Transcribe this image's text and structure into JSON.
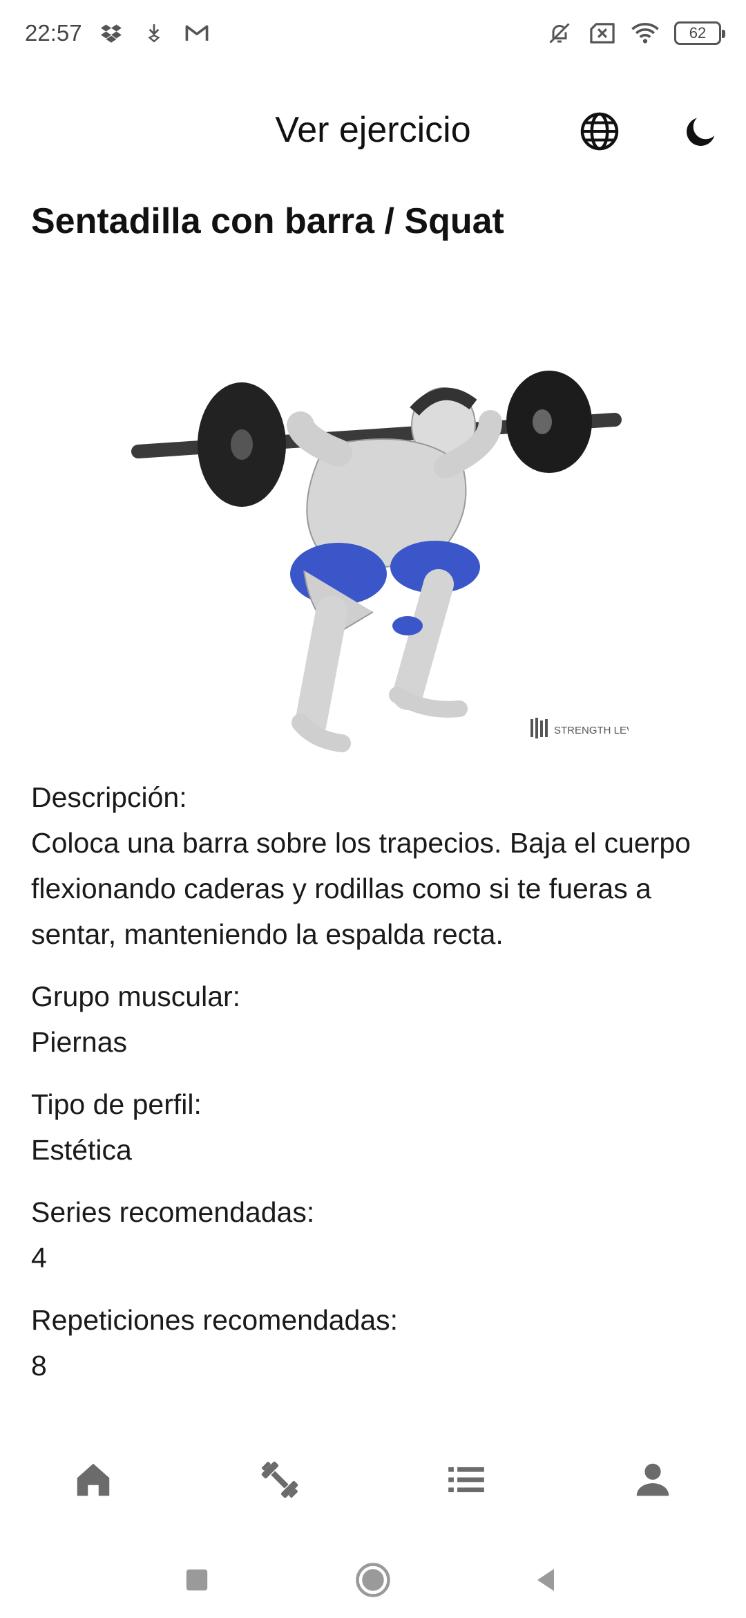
{
  "status_bar": {
    "time": "22:57",
    "battery": "62",
    "left_icons": [
      "dropbox-icon",
      "download-icon",
      "gmail-icon"
    ],
    "right_icons": [
      "bell-off-icon",
      "sim-off-icon",
      "wifi-icon",
      "battery-icon"
    ]
  },
  "app_bar": {
    "title": "Ver ejercicio",
    "actions": [
      "globe-icon",
      "moon-icon"
    ]
  },
  "exercise": {
    "title": "Sentadilla con barra / Squat",
    "image_watermark": "STRENGTH LEVEL",
    "description_label": "Descripción:",
    "description": "Coloca una barra sobre los trapecios. Baja el cuerpo flexionando caderas y rodillas como si te fueras a sentar, manteniendo la espalda recta.",
    "muscle_group_label": "Grupo muscular:",
    "muscle_group": "Piernas",
    "profile_type_label": "Tipo de perfil:",
    "profile_type": "Estética",
    "sets_label": "Series recomendadas:",
    "sets": "4",
    "reps_label": "Repeticiones recomendadas:",
    "reps": "8"
  },
  "bottom_nav": [
    "home-icon",
    "dumbbell-icon",
    "list-icon",
    "person-icon"
  ],
  "colors": {
    "muscle_highlight": "#3a56c8",
    "nav_icon": "#6b6b6b",
    "text": "#111111"
  }
}
